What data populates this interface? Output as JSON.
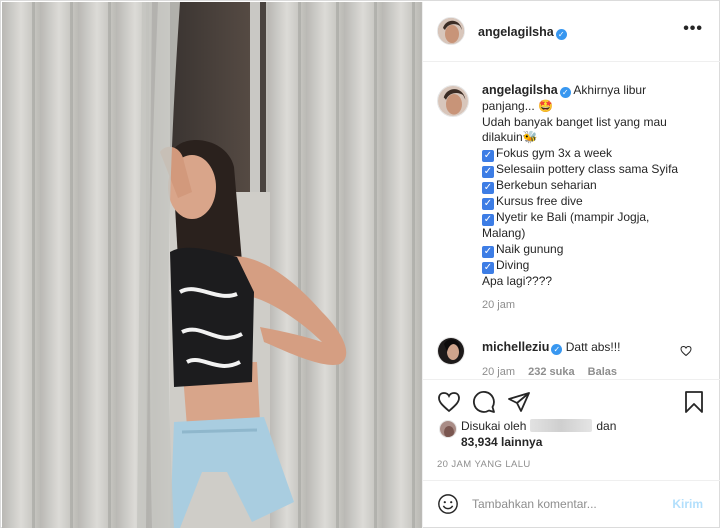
{
  "post": {
    "author": "angelagilsha",
    "more_icon": "more-dots-icon"
  },
  "caption": {
    "author": "angelagilsha",
    "lines": [
      "Akhirnya libur",
      "panjang... 🤩",
      "Udah banyak banget list yang mau",
      "dilakuin🐝"
    ],
    "checklist": [
      "Fokus gym 3x a week",
      "Selesaiin pottery class sama Syifa",
      "Berkebun seharian",
      "Kursus free dive",
      "Nyetir ke Bali (mampir Jogja,",
      "Malang)",
      "Naik gunung",
      "Diving"
    ],
    "closing": "Apa lagi????",
    "time": "20 jam"
  },
  "comment": {
    "author": "michelleziu",
    "text": "Datt abs!!!",
    "time": "20 jam",
    "likes": "232 suka",
    "reply": "Balas"
  },
  "likes": {
    "prefix": "Disukai oleh",
    "conj": "dan",
    "count": "83,934 lainnya"
  },
  "timestamp": "20 JAM YANG LALU",
  "comment_box": {
    "placeholder": "Tambahkan komentar...",
    "post_label": "Kirim"
  },
  "colors": {
    "verified": "#3897f0",
    "checkbox": "#3d7de5",
    "muted": "#8e8e8e",
    "post_disabled": "#b2dffc"
  }
}
